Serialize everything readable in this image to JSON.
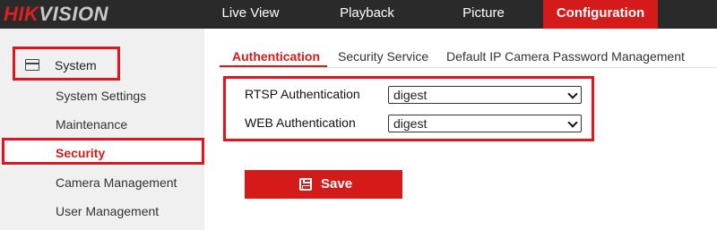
{
  "brand": {
    "logo_red": "HIK",
    "logo_gray": "VISION"
  },
  "nav": [
    {
      "label": "Live View"
    },
    {
      "label": "Playback"
    },
    {
      "label": "Picture"
    },
    {
      "label": "Configuration",
      "active": true
    }
  ],
  "sidebar": {
    "group_label": "System",
    "items": [
      {
        "label": "System Settings"
      },
      {
        "label": "Maintenance"
      },
      {
        "label": "Security",
        "active": true
      },
      {
        "label": "Camera Management"
      },
      {
        "label": "User Management"
      }
    ]
  },
  "tabs": [
    {
      "label": "Authentication",
      "active": true
    },
    {
      "label": "Security Service"
    },
    {
      "label": "Default IP Camera Password Management"
    }
  ],
  "form": {
    "rtsp": {
      "label": "RTSP Authentication",
      "value": "digest"
    },
    "web": {
      "label": "WEB Authentication",
      "value": "digest"
    }
  },
  "save_label": "Save",
  "colors": {
    "accent": "#d51a1a",
    "topbar": "#2a2a2a",
    "sidebar": "#f0f0f0",
    "annotation": "#e3141b"
  }
}
